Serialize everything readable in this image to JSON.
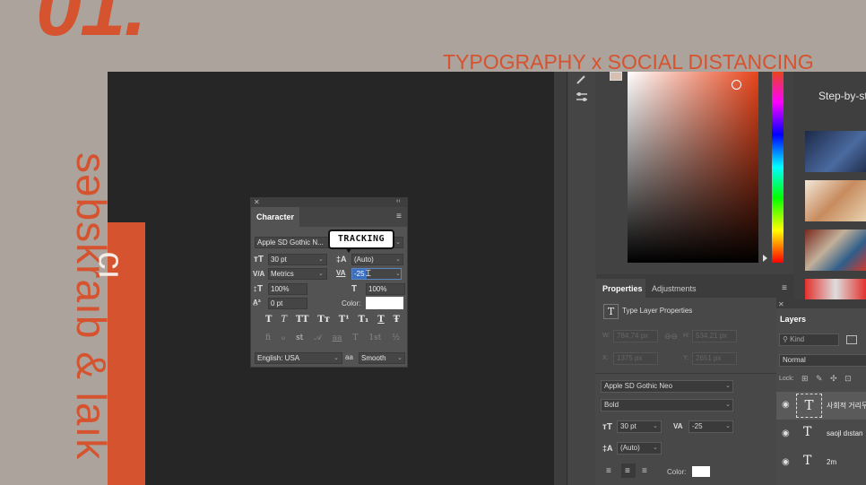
{
  "slide": {
    "number": "01.",
    "headline": "TYPOGRAPHY x SOCIAL DISTANCING",
    "vertical_text": "sәbskraıb & laık",
    "orange_char": "cı"
  },
  "learn_panel": {
    "title": "Step-by-st"
  },
  "character_panel": {
    "title": "Character",
    "font_family": "Apple SD Gothic N...",
    "font_size": "30 pt",
    "leading": "(Auto)",
    "kerning": "Metrics",
    "tracking": "-25",
    "vertical_scale": "100%",
    "horizontal_scale": "100%",
    "baseline_shift": "0 pt",
    "color_label": "Color:",
    "language": "English: USA",
    "antialias_icon": "aa",
    "antialias": "Smooth",
    "style_buttons": [
      "T",
      "T",
      "TT",
      "Tт",
      "T¹",
      "T₁",
      "T",
      "Ŧ"
    ],
    "opentype_buttons": [
      "fi",
      "ℴ",
      "st",
      "𝒜",
      "aa",
      "T",
      "1st",
      "½"
    ]
  },
  "annotation": {
    "tracking_bubble": "TRACKING"
  },
  "properties_panel": {
    "tabs": [
      "Properties",
      "Adjustments"
    ],
    "header": "Type Layer Properties",
    "w_label": "W:",
    "w_value": "784.74 px",
    "h_label": "H:",
    "h_value": "534.21 px",
    "x_label": "X:",
    "x_value": "1375 px",
    "y_label": "Y:",
    "y_value": "2651 px",
    "font_family": "Apple SD Gothic Neo",
    "font_style": "Bold",
    "font_size": "30 pt",
    "tracking": "-25",
    "leading": "(Auto)",
    "color_label": "Color:"
  },
  "layers_panel": {
    "title": "Layers",
    "search": "Kind",
    "blend_mode": "Normal",
    "lock_label": "Lock:",
    "layers": [
      {
        "name": "사회적 거리두"
      },
      {
        "name": "saojl dıstan"
      },
      {
        "name": "2m"
      }
    ]
  },
  "colors": {
    "accent": "#d6532f",
    "background": "#aba39c"
  }
}
